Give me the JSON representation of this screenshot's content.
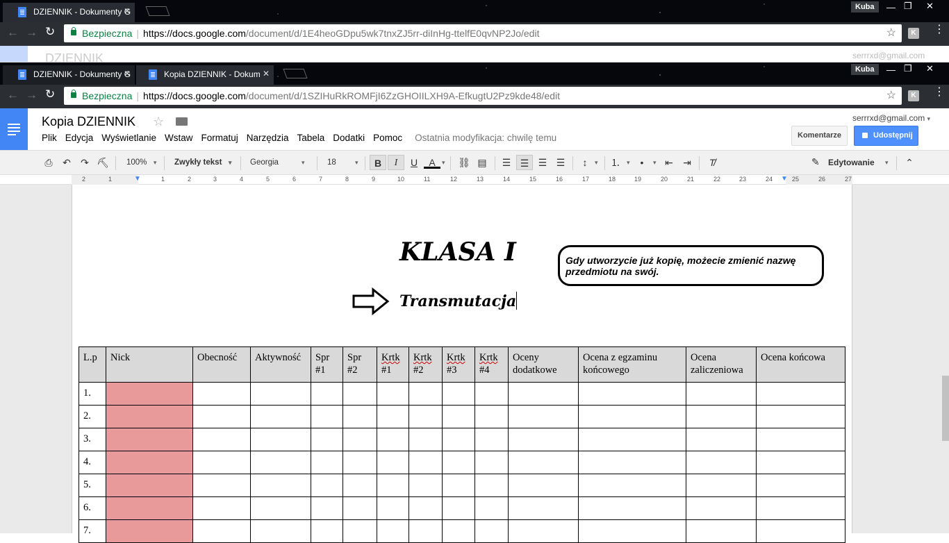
{
  "window1": {
    "tab_title": "DZIENNIK - Dokumenty G",
    "user_badge": "Kuba",
    "secure_label": "Bezpieczna",
    "url_host": "https://docs.google.com",
    "url_path": "/document/d/1E4heoGDpu5wk7tnxZJ5rr-diInHg-ttelfE0qvNP2Jo/edit",
    "ghost_title": "DZIENNIK",
    "ghost_email": "serrrxd@gmail.com"
  },
  "window2": {
    "tab1_title": "DZIENNIK - Dokumenty G",
    "tab2_title": "Kopia DZIENNIK - Dokum",
    "user_badge": "Kuba",
    "secure_label": "Bezpieczna",
    "url_host": "https://docs.google.com",
    "url_path": "/document/d/1SZIHuRkROMFjI6ZzGHOIILXH9A-EfkugtU2Pz9kde48/edit"
  },
  "ext_letter": "K",
  "docs": {
    "title": "Kopia  DZIENNIK",
    "menu": [
      "Plik",
      "Edycja",
      "Wyświetlanie",
      "Wstaw",
      "Formatuj",
      "Narzędzia",
      "Tabela",
      "Dodatki",
      "Pomoc"
    ],
    "last_modified": "Ostatnia modyfikacja: chwilę temu",
    "email": "serrrxd@gmail.com",
    "comments_btn": "Komentarze",
    "share_btn": "Udostępnij",
    "toolbar": {
      "zoom": "100%",
      "style": "Zwykły tekst",
      "font": "Georgia",
      "size": "18",
      "mode": "Edytowanie"
    }
  },
  "ruler": [
    "2",
    "1",
    "1",
    "2",
    "3",
    "4",
    "5",
    "6",
    "7",
    "8",
    "9",
    "10",
    "11",
    "12",
    "13",
    "14",
    "15",
    "16",
    "17",
    "18",
    "19",
    "20",
    "21",
    "22",
    "23",
    "24",
    "25",
    "26",
    "27"
  ],
  "document": {
    "heading": "KLASA I",
    "subject": "Transmutacja",
    "note": "Gdy utworzycie już kopię, możecie zmienić nazwę przedmiotu na swój.",
    "table_headers": [
      [
        "L.p"
      ],
      [
        "Nick"
      ],
      [
        "Obecność"
      ],
      [
        "Aktywność"
      ],
      [
        "Spr",
        "#1"
      ],
      [
        "Spr",
        "#2"
      ],
      [
        "Krtk",
        "#1"
      ],
      [
        "Krtk",
        "#2"
      ],
      [
        "Krtk",
        "#3"
      ],
      [
        "Krtk",
        "#4"
      ],
      [
        "Oceny",
        "dodatkowe"
      ],
      [
        "Ocena z egzaminu",
        "końcowego"
      ],
      [
        "Ocena",
        "zaliczeniowa"
      ],
      [
        "Ocena końcowa"
      ]
    ],
    "rows": [
      "1.",
      "2.",
      "3.",
      "4.",
      "5.",
      "6.",
      "7."
    ]
  }
}
